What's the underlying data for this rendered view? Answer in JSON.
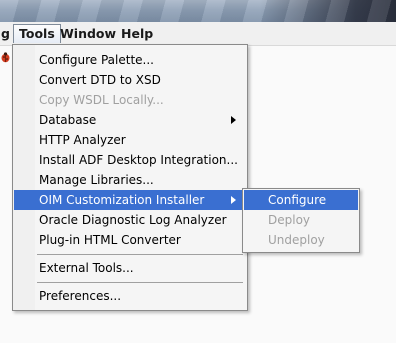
{
  "menubar": {
    "partial_label": "g",
    "items": [
      "Tools",
      "Window",
      "Help"
    ]
  },
  "tools_menu": {
    "items": [
      "Configure Palette...",
      "Convert DTD to XSD",
      "Copy WSDL Locally...",
      "Database",
      "HTTP Analyzer",
      "Install ADF Desktop Integration...",
      "Manage Libraries...",
      "OIM Customization Installer",
      "Oracle Diagnostic Log Analyzer",
      "Plug-in HTML Converter",
      "External Tools...",
      "Preferences..."
    ]
  },
  "submenu": {
    "items": [
      "Configure",
      "Deploy",
      "Undeploy"
    ]
  },
  "colors": {
    "highlight": "#3a6fd1",
    "disabled_text": "#a0a0a0"
  },
  "icons": [
    "bug-icon",
    "submenu-arrow-icon"
  ]
}
